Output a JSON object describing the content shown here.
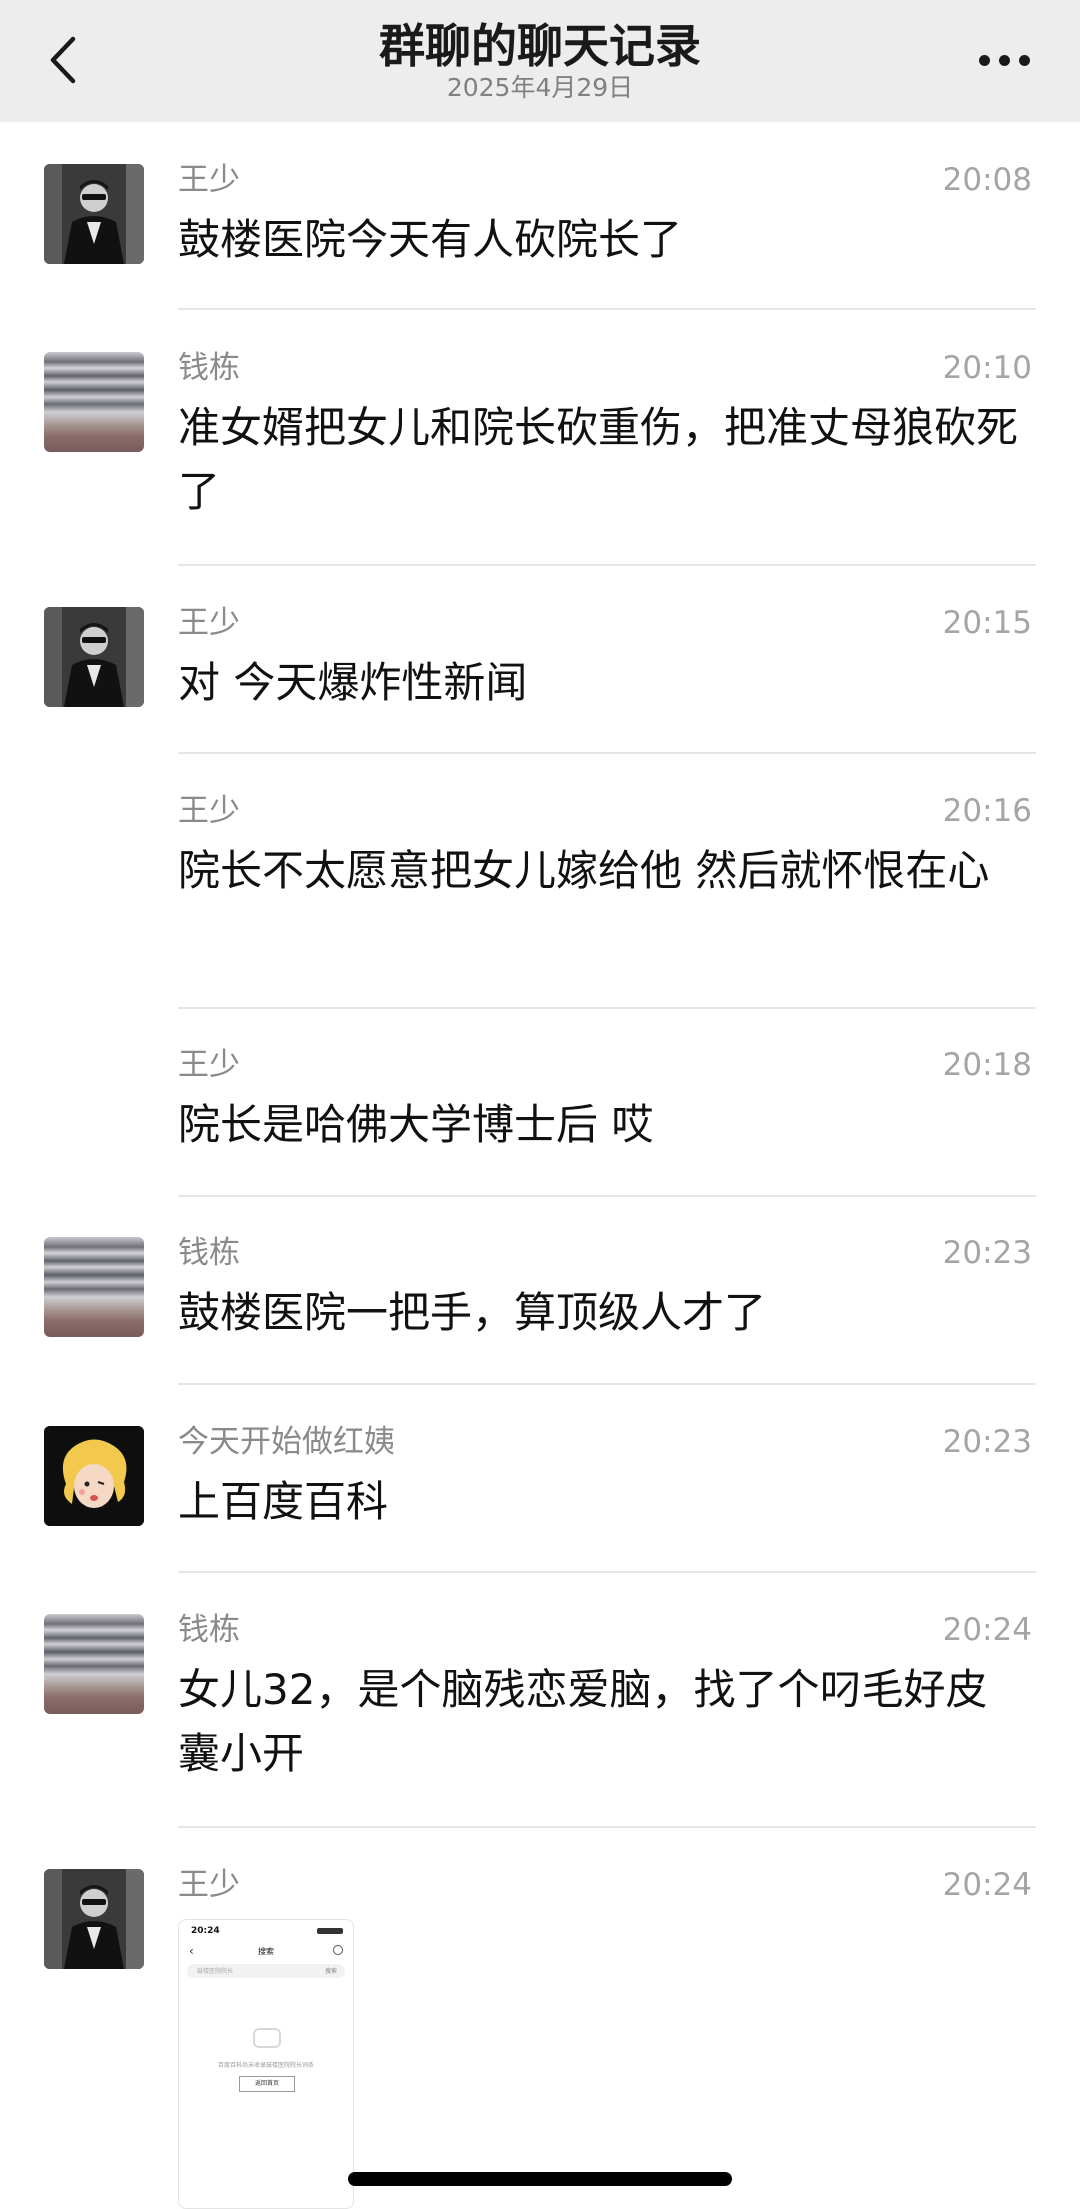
{
  "header": {
    "title": "群聊的聊天记录",
    "date": "2025年4月29日"
  },
  "messages": [
    {
      "sender": "王少",
      "time": "20:08",
      "text": "鼓楼医院今天有人砍院长了"
    },
    {
      "sender": "钱栋",
      "time": "20:10",
      "text": "准女婿把女儿和院长砍重伤，把准丈母狼砍死了"
    },
    {
      "sender": "王少",
      "time": "20:15",
      "text": "对 今天爆炸性新闻"
    },
    {
      "sender": "王少",
      "time": "20:16",
      "text": "院长不太愿意把女儿嫁给他 然后就怀恨在心"
    },
    {
      "sender": "王少",
      "time": "20:18",
      "text": "院长是哈佛大学博士后 哎"
    },
    {
      "sender": "钱栋",
      "time": "20:23",
      "text": "鼓楼医院一把手，算顶级人才了"
    },
    {
      "sender": "今天开始做红姨",
      "time": "20:23",
      "text": "上百度百科"
    },
    {
      "sender": "钱栋",
      "time": "20:24",
      "text": "女儿32，是个脑残恋爱脑，找了个叼毛好皮囊小开"
    },
    {
      "sender": "王少",
      "time": "20:24",
      "text": ""
    }
  ],
  "thumbnail": {
    "status_time": "20:24",
    "page_title": "搜索",
    "search_placeholder": "鼓楼医院院长",
    "search_action": "搜索",
    "empty_message": "百度百科尚未收录鼓楼医院院长词条",
    "return_button": "返回首页"
  }
}
